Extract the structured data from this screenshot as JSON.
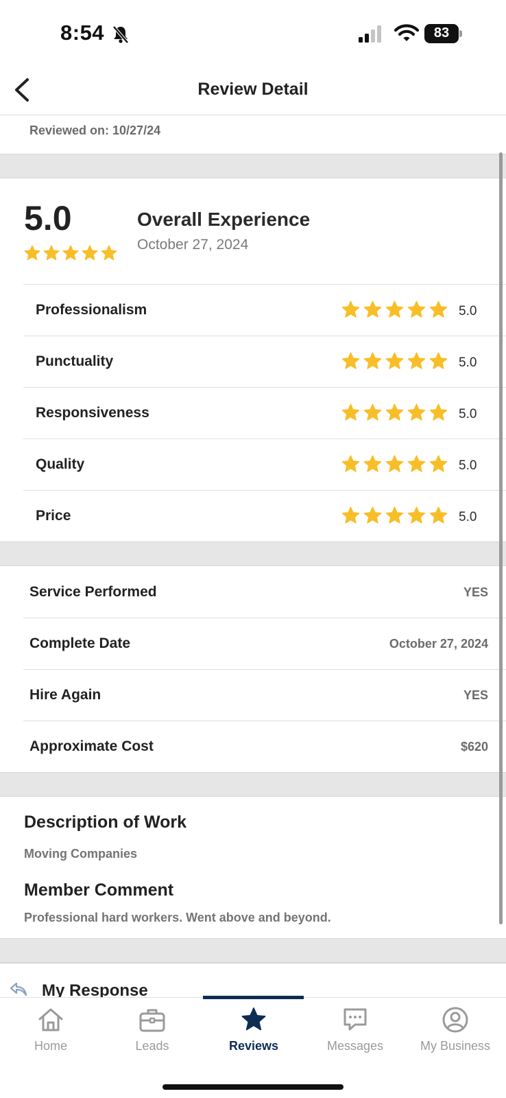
{
  "status_bar": {
    "time": "8:54",
    "battery": "83"
  },
  "header": {
    "title": "Review Detail"
  },
  "reviewed_on": "Reviewed on: 10/27/24",
  "overall": {
    "score": "5.0",
    "rating": 5,
    "title": "Overall Experience",
    "date": "October 27, 2024"
  },
  "ratings": [
    {
      "label": "Professionalism",
      "value": "5.0",
      "stars": 5
    },
    {
      "label": "Punctuality",
      "value": "5.0",
      "stars": 5
    },
    {
      "label": "Responsiveness",
      "value": "5.0",
      "stars": 5
    },
    {
      "label": "Quality",
      "value": "5.0",
      "stars": 5
    },
    {
      "label": "Price",
      "value": "5.0",
      "stars": 5
    }
  ],
  "details": [
    {
      "label": "Service Performed",
      "value": "YES"
    },
    {
      "label": "Complete Date",
      "value": "October 27, 2024"
    },
    {
      "label": "Hire Again",
      "value": "YES"
    },
    {
      "label": "Approximate Cost",
      "value": "$620"
    }
  ],
  "description": {
    "heading": "Description of Work",
    "text": "Moving Companies"
  },
  "comment": {
    "heading": "Member Comment",
    "text": "Professional hard workers. Went above and beyond."
  },
  "response": {
    "title": "My Response"
  },
  "tabs": [
    {
      "label": "Home",
      "icon": "home-icon",
      "active": false
    },
    {
      "label": "Leads",
      "icon": "briefcase-icon",
      "active": false
    },
    {
      "label": "Reviews",
      "icon": "star-icon",
      "active": true
    },
    {
      "label": "Messages",
      "icon": "chat-icon",
      "active": false
    },
    {
      "label": "My Business",
      "icon": "user-circle-icon",
      "active": false
    }
  ],
  "colors": {
    "star": "#F8BE28",
    "brand": "#0D2D55",
    "tab_inactive": "#9A9A9A"
  }
}
